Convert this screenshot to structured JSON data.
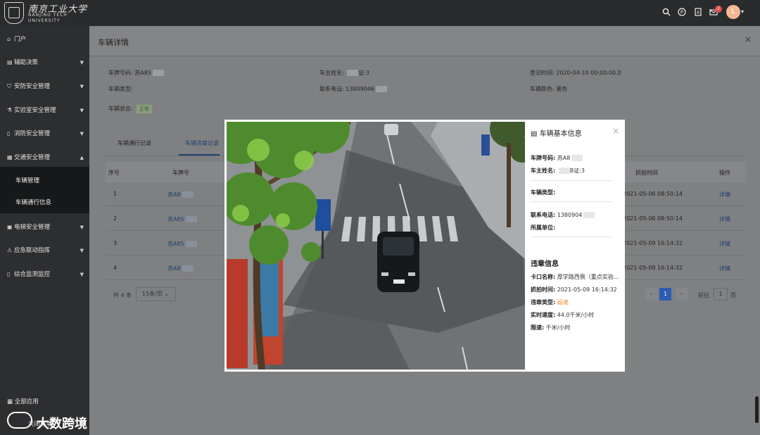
{
  "header": {
    "brand_cn": "南京工业大学",
    "brand_en_line1": "NANJING TECH",
    "brand_en_line2": "UNIVERSITY",
    "notification_count": "2",
    "avatar_letter": "L"
  },
  "sidebar": {
    "items": [
      {
        "label": "门户"
      },
      {
        "label": "辅助决策"
      },
      {
        "label": "安防安全管理"
      },
      {
        "label": "实验室安全管理"
      },
      {
        "label": "消防安全管理"
      },
      {
        "label": "交通安全管理"
      },
      {
        "label": "电梯安全管理"
      },
      {
        "label": "应急联动指挥"
      },
      {
        "label": "综合监测监控"
      }
    ],
    "submenu": [
      "车辆管理",
      "车辆通行信息"
    ],
    "bottom": [
      "全部应用",
      "关闭菜单"
    ]
  },
  "panel": {
    "title": "车辆详情",
    "fields": {
      "plate_label": "车牌号码:",
      "plate_value": "苏A85",
      "owner_label": "车主姓名:",
      "owner_value": "证:3",
      "reg_time_label": "登记时间:",
      "reg_time_value": "2020-04-10 00:00:00.0",
      "type_label": "车辆类型:",
      "phone_label": "联系电话:",
      "phone_value": "13809046",
      "color_label": "车辆颜色:",
      "color_value": "黑色",
      "status_label": "车辆状态:",
      "status_value": "正常"
    },
    "tabs": [
      "车辆通行记录",
      "车辆违章记录"
    ],
    "table": {
      "headers": [
        "序号",
        "车牌号",
        "抓拍时间",
        "操作"
      ],
      "rows": [
        {
          "index": "1",
          "plate": "苏A8",
          "time": "2021-05-06 08:50:14",
          "action": "详情"
        },
        {
          "index": "2",
          "plate": "苏A85",
          "time": "2021-05-06 08:50:14",
          "action": "详情"
        },
        {
          "index": "3",
          "plate": "苏A85",
          "time": "2021-05-09 16:14:32",
          "action": "详情"
        },
        {
          "index": "4",
          "plate": "苏A8",
          "time": "2021-05-09 16:14:32",
          "action": "详情"
        }
      ]
    },
    "pagination": {
      "total": "共 4 条",
      "page_size": "15条/页",
      "current_page": "1",
      "goto_label": "前往",
      "goto_value": "1",
      "page_suffix": "页"
    }
  },
  "modal": {
    "basic_title": "车辆基本信息",
    "plate_label": "车牌号码:",
    "plate_value": "苏A8",
    "owner_label": "车主姓名:",
    "owner_value": "B证:3",
    "type_label": "车辆类型:",
    "phone_label": "联系电话:",
    "phone_value": "1380904",
    "unit_label": "所属单位:",
    "violation_title": "违章信息",
    "gate_label": "卡口名称:",
    "gate_value": "厚学路西侧（重点实验...",
    "capture_label": "抓拍时间:",
    "capture_value": "2021-05-09 16:14:32",
    "vtype_label": "违章类型:",
    "vtype_value": "超速",
    "speed_label": "实时速度:",
    "speed_value": "44.0千米/小时",
    "limit_label": "限速:",
    "limit_value": "千米/小时"
  },
  "watermark": {
    "text": "大数跨境"
  }
}
